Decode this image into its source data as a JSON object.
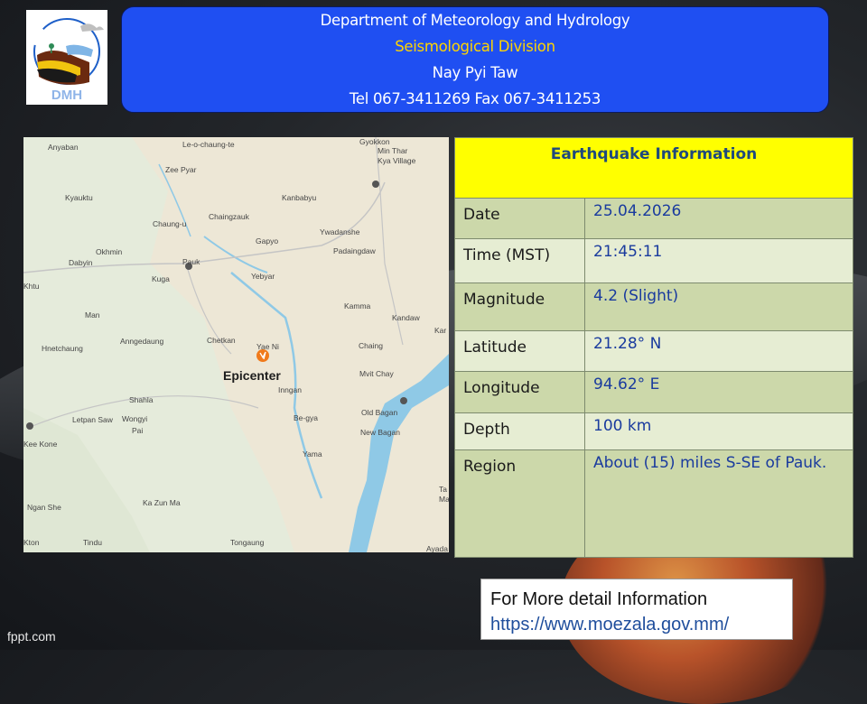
{
  "header": {
    "line1": "Department of Meteorology and Hydrology",
    "line2": "Seismological Division",
    "line3": "Nay Pyi Taw",
    "line4": "Tel 067-3411269 Fax 067-3411253",
    "logo_text": "DMH"
  },
  "map": {
    "epicenter_label": "Epicenter",
    "places": [
      "Anyaban",
      "Le-o-chaung-te",
      "Gyokkon",
      "Min Thar",
      "Kya Village",
      "Zee Pyar",
      "Kyauktu",
      "Kanbabyu",
      "Chaung-u",
      "Chaingzauk",
      "Gapyo",
      "Ywadanshe",
      "Padaingdaw",
      "Okhmin",
      "Dabyin",
      "Kuga",
      "Pauk",
      "Yebyar",
      "Kamma",
      "Kandaw",
      "Man",
      "Hnetchaung",
      "Anngedaung",
      "Chetkan",
      "Yae Ni",
      "Chaing",
      "Mvit Chay",
      "Shahla",
      "Inngan",
      "Letpan Saw",
      "Wongyi",
      "Pai",
      "Be-gya",
      "Old Bagan",
      "New Bagan",
      "Yama",
      "Kee Kone",
      "Ka Zun Ma",
      "Ngan She",
      "Tindu",
      "Tongaung",
      "Kton",
      "Ta",
      "Ma",
      "Ayada",
      "Kar",
      "Khtu"
    ]
  },
  "info": {
    "title": "Earthquake Information",
    "rows": [
      {
        "label": "Date",
        "value": "25.04.2026"
      },
      {
        "label": "Time (MST)",
        "value": "21:45:11"
      },
      {
        "label": "Magnitude",
        "value": "4.2 (Slight)"
      },
      {
        "label": "Latitude",
        "value": "21.28° N"
      },
      {
        "label": "Longitude",
        "value": "94.62° E"
      },
      {
        "label": "Depth",
        "value": "100 km"
      },
      {
        "label": "Region",
        "value": "About (15) miles S-SE of Pauk."
      }
    ]
  },
  "more": {
    "text": "For More detail Information",
    "url": "https://www.moezala.gov.mm/"
  },
  "footer": "fppt.com",
  "colors": {
    "header_bg": "#1f4ff2",
    "header_highlight": "#ffd400",
    "table_head": "#ffff00",
    "table_row_dark": "#ccd8aa",
    "table_row_light": "#e6edd3",
    "epicenter": "#f07a1a"
  }
}
